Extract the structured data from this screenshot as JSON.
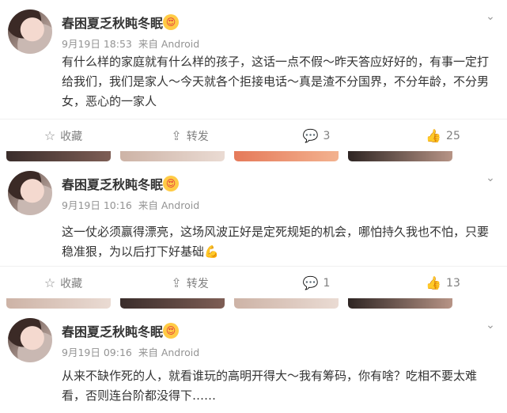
{
  "posts": [
    {
      "author": "春困夏乏秋盹冬眠",
      "date": "9月19日 18:53",
      "source": "来自 Android",
      "content": "有什么样的家庭就有什么样的孩子，这话一点不假～昨天答应好好的，有事一定打给我们，我们是家人～今天就各个拒接电话～真是渣不分国界，不分年龄，不分男女，恶心的一家人",
      "actions": {
        "fav": "收藏",
        "forward": "转发",
        "comments": "3",
        "likes": "25"
      }
    },
    {
      "author": "春困夏乏秋盹冬眠",
      "date": "9月19日 10:16",
      "source": "来自 Android",
      "content": "这一仗必须赢得漂亮，这场风波正好是定死规矩的机会，哪怕持久我也不怕，只要稳准狠，为以后打下好基础💪",
      "actions": {
        "fav": "收藏",
        "forward": "转发",
        "comments": "1",
        "likes": "13"
      }
    },
    {
      "author": "春困夏乏秋盹冬眠",
      "date": "9月19日 09:16",
      "source": "来自 Android",
      "content": "从来不缺作死的人，就看谁玩的高明开得大～我有筹码，你有啥？吃相不要太难看，否则连台阶都没得下……"
    }
  ],
  "icons": {
    "fav": "star-icon",
    "forward": "share-icon",
    "comment": "comment-icon",
    "like": "thumb-up-icon",
    "more": "chevron-down-icon"
  }
}
